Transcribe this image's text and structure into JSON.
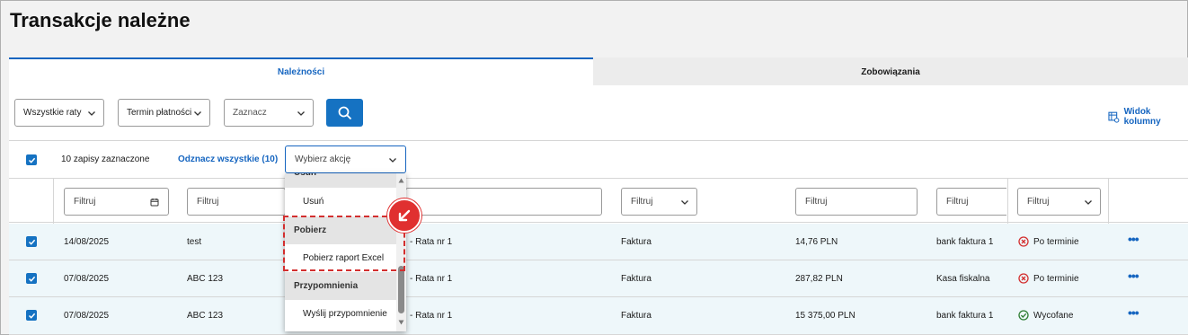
{
  "page": {
    "title": "Transakcje należne"
  },
  "tabs": [
    {
      "label": "Należności",
      "active": true
    },
    {
      "label": "Zobowiązania",
      "active": false
    }
  ],
  "filters": {
    "installments": "Wszystkie raty",
    "payment_term": "Termin płatności",
    "mark": "Zaznacz",
    "search_icon": "search-icon",
    "view_columns_label": "Widok kolumny"
  },
  "selection": {
    "count_text": "10 zapisy zaznaczone",
    "deselect_all": "Odznacz wszystkie (10)",
    "action_placeholder": "Wybierz akcję"
  },
  "column_filters": {
    "placeholder": "Filtruj"
  },
  "dropdown": {
    "groups": [
      {
        "label": "Usuń",
        "items": [
          "Usuń"
        ]
      },
      {
        "label": "Pobierz",
        "items": [
          "Pobierz raport Excel"
        ]
      },
      {
        "label": "Przypomnienia",
        "items": [
          "Wyślij przypomnienie"
        ]
      }
    ]
  },
  "rows": [
    {
      "date": "14/08/2025",
      "name": "test",
      "installment": "- Rata nr 1",
      "doc_type": "Faktura",
      "amount": "14,76 PLN",
      "account": "bank faktura 1",
      "status": "Po terminie",
      "status_type": "overdue"
    },
    {
      "date": "07/08/2025",
      "name": "ABC 123",
      "installment": "- Rata nr 1",
      "doc_type": "Faktura",
      "amount": "287,82 PLN",
      "account": "Kasa fiskalna",
      "status": "Po terminie",
      "status_type": "overdue"
    },
    {
      "date": "07/08/2025",
      "name": "ABC 123",
      "installment": "- Rata nr 1",
      "doc_type": "Faktura",
      "amount": "15 375,00 PLN",
      "account": "bank faktura 1",
      "status": "Wycofane",
      "status_type": "withdrawn"
    }
  ],
  "colors": {
    "accent": "#1572c2",
    "overdue": "#d32f2f",
    "withdrawn": "#2e7d32",
    "highlight": "#d32f2f"
  }
}
